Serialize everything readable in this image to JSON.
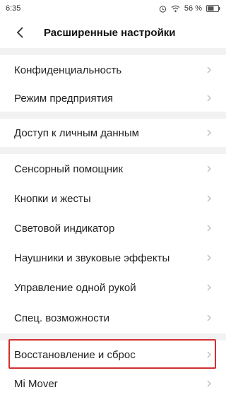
{
  "status": {
    "time": "6:35",
    "battery_text": "56 %"
  },
  "header": {
    "title": "Расширенные настройки",
    "back_icon": "chevron-left-icon"
  },
  "groups": [
    {
      "items": [
        "Конфиденциальность",
        "Режим предприятия"
      ]
    },
    {
      "items": [
        "Доступ к личным данным"
      ]
    },
    {
      "items": [
        "Сенсорный помощник",
        "Кнопки и жесты",
        "Световой индикатор",
        "Наушники и звуковые эффекты",
        "Управление одной рукой",
        "Спец. возможности"
      ]
    },
    {
      "items": [
        "Восстановление и сброс",
        "Mi Mover"
      ]
    }
  ],
  "colors": {
    "highlight": "#d32f2f",
    "separator": "#f2f2f2"
  }
}
